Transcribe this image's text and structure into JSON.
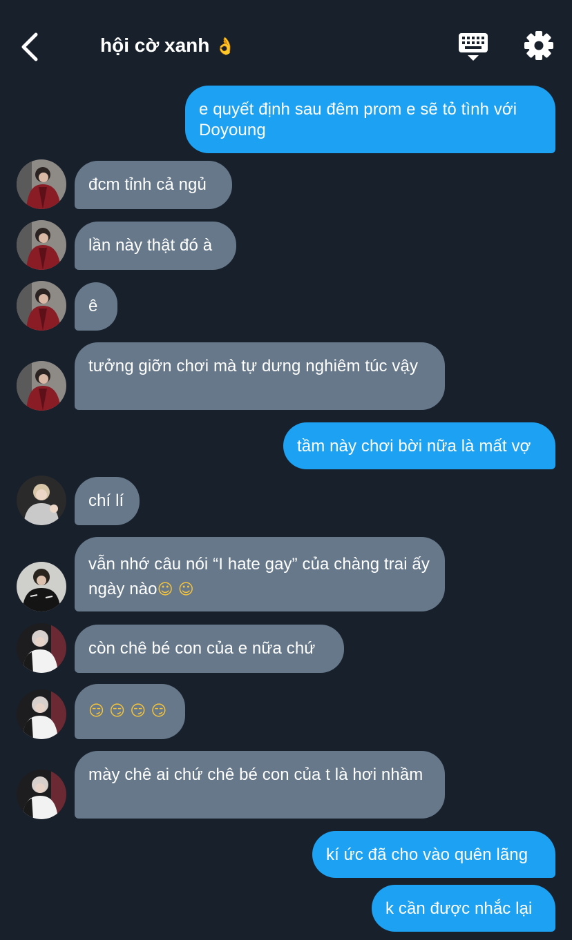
{
  "header": {
    "title": "hội cờ xanh",
    "title_emoji": "👌",
    "back_icon": "chevron-left-icon",
    "keyboard_icon": "keyboard-icon",
    "settings_icon": "gear-icon"
  },
  "colors": {
    "background": "#18202b",
    "outgoing_bubble": "#1da1f2",
    "incoming_bubble": "#66788a",
    "text": "#ffffff"
  },
  "messages": [
    {
      "text": "e quyết định sau đêm prom e sẽ tỏ tình với Doyoung",
      "direction": "outgoing"
    },
    {
      "text": "đcm tỉnh cả ngủ",
      "direction": "incoming",
      "avatar": "user-a"
    },
    {
      "text": "lần này thật đó à",
      "direction": "incoming",
      "avatar": "user-a"
    },
    {
      "text": "ê",
      "direction": "incoming",
      "avatar": "user-a"
    },
    {
      "text": "tưởng giỡn chơi mà tự dưng nghiêm túc vậy",
      "direction": "incoming",
      "avatar": "user-a"
    },
    {
      "text": "tầm này chơi bời nữa là mất vợ",
      "direction": "outgoing"
    },
    {
      "text": "chí lí",
      "direction": "incoming",
      "avatar": "user-b"
    },
    {
      "text": "vẫn nhớ câu nói “I hate gay” của chàng trai ấy ngày nào",
      "emoji": "☺ ☺",
      "direction": "incoming",
      "avatar": "user-c"
    },
    {
      "text": "còn chê bé con của e nữa chứ",
      "direction": "incoming",
      "avatar": "user-d"
    },
    {
      "text": "",
      "emoji": "😏 😏 😏 😏",
      "direction": "incoming",
      "avatar": "user-d"
    },
    {
      "text": "mày chê ai chứ chê bé con của t là hơi nhầm",
      "direction": "incoming",
      "avatar": "user-d"
    },
    {
      "text": "kí ức đã cho vào quên lãng",
      "direction": "outgoing"
    },
    {
      "text": "k cần được nhắc lại",
      "direction": "outgoing"
    }
  ]
}
